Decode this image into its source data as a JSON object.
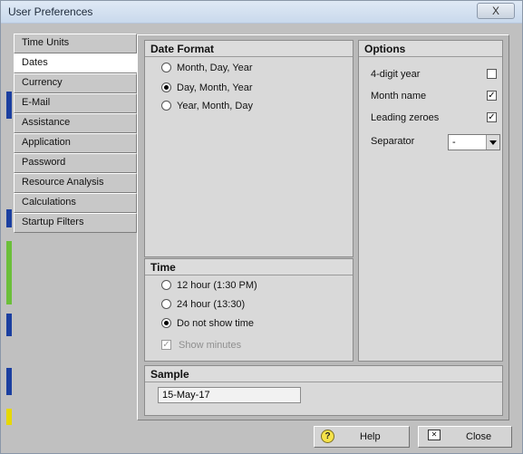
{
  "window": {
    "title": "User Preferences",
    "close_glyph": "X"
  },
  "nav": {
    "items": [
      {
        "label": "Time Units"
      },
      {
        "label": "Dates",
        "active": true
      },
      {
        "label": "Currency"
      },
      {
        "label": "E-Mail"
      },
      {
        "label": "Assistance"
      },
      {
        "label": "Application"
      },
      {
        "label": "Password"
      },
      {
        "label": "Resource Analysis"
      },
      {
        "label": "Calculations"
      },
      {
        "label": "Startup Filters"
      }
    ]
  },
  "date_format": {
    "header": "Date Format",
    "options": [
      {
        "label": "Month, Day, Year",
        "selected": false
      },
      {
        "label": "Day, Month, Year",
        "selected": true
      },
      {
        "label": "Year, Month, Day",
        "selected": false
      }
    ]
  },
  "options": {
    "header": "Options",
    "four_digit_year": {
      "label": "4-digit year",
      "checked": false
    },
    "month_name": {
      "label": "Month name",
      "checked": true
    },
    "leading_zeroes": {
      "label": "Leading zeroes",
      "checked": true
    },
    "separator": {
      "label": "Separator",
      "value": "-"
    }
  },
  "time": {
    "header": "Time",
    "options": [
      {
        "label": "12 hour (1:30 PM)",
        "selected": false
      },
      {
        "label": "24 hour (13:30)",
        "selected": false
      },
      {
        "label": "Do not show time",
        "selected": true
      }
    ],
    "show_minutes": {
      "label": "Show minutes",
      "checked": true,
      "enabled": false
    }
  },
  "sample": {
    "header": "Sample",
    "value": "15-May-17"
  },
  "buttons": {
    "help": "Help",
    "help_icon_glyph": "?",
    "close": "Close"
  },
  "icons": {
    "help": "help-icon",
    "close": "close-window-icon"
  },
  "colors": {
    "panel_bg": "#b9b9b9",
    "group_bg": "#d9d9d9",
    "title_gradient_top": "#dfe9f5",
    "accent_left_edge_blue": "#1b3fa0",
    "accent_left_edge_green": "#6bbf3a",
    "accent_left_edge_yellow": "#e6d800"
  }
}
